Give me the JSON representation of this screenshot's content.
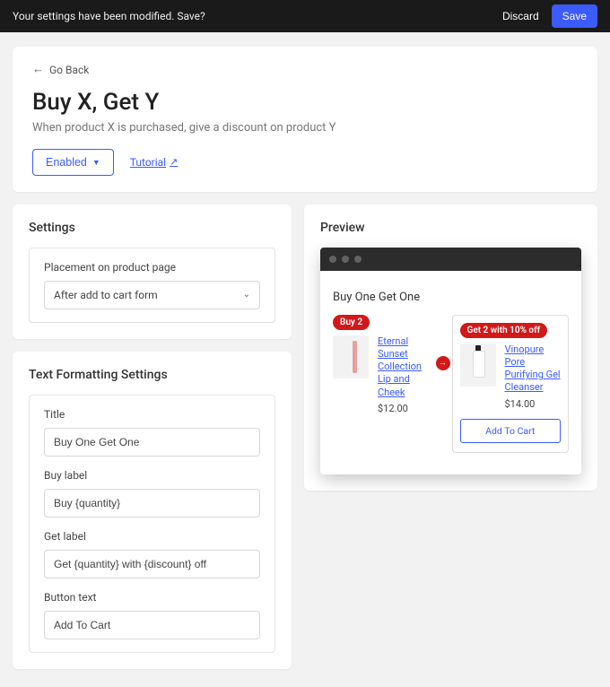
{
  "save_bar": {
    "message": "Your settings have been modified. Save?",
    "discard": "Discard",
    "save": "Save"
  },
  "hero": {
    "go_back": "Go Back",
    "title": "Buy X, Get Y",
    "subtitle": "When product X is purchased, give a discount on product Y",
    "enabled_label": "Enabled",
    "tutorial_label": "Tutorial"
  },
  "settings": {
    "title": "Settings",
    "placement_label": "Placement on product page",
    "placement_value": "After add to cart form"
  },
  "text_formatting": {
    "title": "Text Formatting Settings",
    "fields": {
      "title": {
        "label": "Title",
        "value": "Buy One Get One"
      },
      "buy_label": {
        "label": "Buy label",
        "value": "Buy {quantity}"
      },
      "get_label": {
        "label": "Get label",
        "value": "Get {quantity} with {discount} off"
      },
      "button_text": {
        "label": "Button text",
        "value": "Add To Cart"
      }
    }
  },
  "preview": {
    "title": "Preview",
    "offer_title": "Buy One Get One",
    "buy_badge": "Buy 2",
    "get_badge": "Get 2 with 10% off",
    "product_a": {
      "name": "Eternal Sunset Collection Lip and Cheek",
      "price": "$12.00"
    },
    "product_b": {
      "name": "Vinopure Pore Purifying Gel Cleanser",
      "price": "$14.00"
    },
    "add_to_cart": "Add To Cart"
  }
}
